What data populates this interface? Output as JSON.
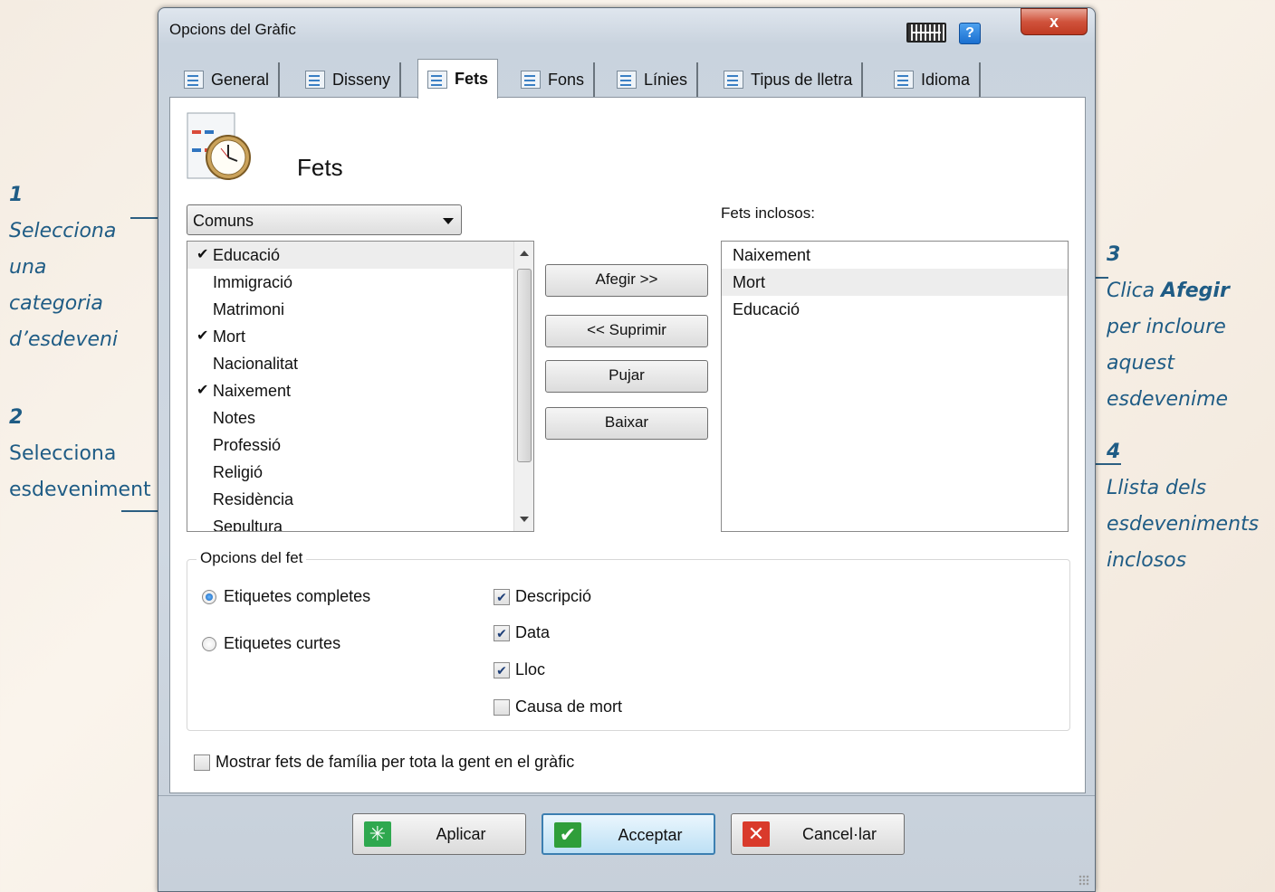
{
  "window": {
    "title": "Opcions del Gràfic",
    "help_label": "?",
    "close_label": "x",
    "keyboard_icon": "keyboard-icon"
  },
  "tabs": [
    {
      "label": "General",
      "icon": "general-tab-icon"
    },
    {
      "label": "Disseny",
      "icon": "design-tab-icon"
    },
    {
      "label": "Fets",
      "icon": "facts-tab-icon",
      "active": true
    },
    {
      "label": "Fons",
      "icon": "background-tab-icon"
    },
    {
      "label": "Línies",
      "icon": "lines-tab-icon"
    },
    {
      "label": "Tipus de lletra",
      "icon": "font-tab-icon"
    },
    {
      "label": "Idioma",
      "icon": "language-tab-icon"
    }
  ],
  "panel": {
    "header_title": "Fets",
    "category_value": "Comuns",
    "included_caption": "Fets inclosos:"
  },
  "available_facts": [
    {
      "label": "Educació",
      "checked": true,
      "selected": true
    },
    {
      "label": "Immigració",
      "checked": false
    },
    {
      "label": "Matrimoni",
      "checked": false
    },
    {
      "label": "Mort",
      "checked": true
    },
    {
      "label": "Nacionalitat",
      "checked": false
    },
    {
      "label": "Naixement",
      "checked": true
    },
    {
      "label": "Notes",
      "checked": false
    },
    {
      "label": "Professió",
      "checked": false
    },
    {
      "label": "Religió",
      "checked": false
    },
    {
      "label": "Residència",
      "checked": false
    },
    {
      "label": "Sepultura",
      "checked": false
    }
  ],
  "included_facts": [
    {
      "label": "Naixement"
    },
    {
      "label": "Mort",
      "selected": true
    },
    {
      "label": "Educació"
    }
  ],
  "buttons": {
    "add": "Afegir >>",
    "remove": "<< Suprimir",
    "up": "Pujar",
    "down": "Baixar"
  },
  "options": {
    "group_title": "Opcions del fet",
    "radio_full": "Etiquetes completes",
    "radio_short": "Etiquetes curtes",
    "radio_selected": "full",
    "chk_description": "Descripció",
    "chk_date": "Data",
    "chk_place": "Lloc",
    "chk_cause": "Causa de mort",
    "family_facts": "Mostrar fets de família per tota la gent en el gràfic"
  },
  "footer": {
    "apply": "Aplicar",
    "accept": "Acceptar",
    "cancel": "Cancel·lar"
  },
  "annotations": {
    "a1_num": "1",
    "a1_lines": [
      "Selecciona",
      "una",
      "categoria",
      "d’esdeveni"
    ],
    "a2_num": "2",
    "a2_lines": [
      "Selecciona",
      "esdeveniment"
    ],
    "a3_num": "3",
    "a3_pre": "Clica ",
    "a3_bold": "Afegir",
    "a3_lines": [
      "per incloure",
      "aquest",
      "esdevenime"
    ],
    "a4_num": "4",
    "a4_lines": [
      "Llista dels",
      "esdeveniments",
      "inclosos"
    ]
  },
  "colors": {
    "annotation": "#1f5c85",
    "apply_icon": "#2fa84f",
    "accept_icon": "#2f9e3a",
    "cancel_icon": "#d93a2b"
  }
}
